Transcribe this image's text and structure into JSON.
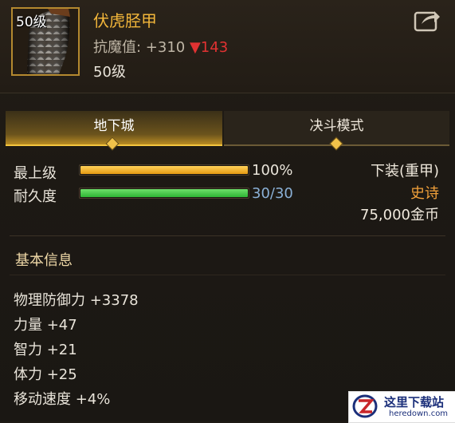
{
  "item": {
    "level_badge": "50级",
    "name": "伏虎胫甲",
    "stat_label": "抗魔值: +310",
    "stat_diff": "▼143",
    "level_text": "50级"
  },
  "tabs": [
    {
      "label": "地下城",
      "active": true
    },
    {
      "label": "决斗模式",
      "active": false
    }
  ],
  "bars": {
    "top_level": {
      "label": "最上级",
      "value_text": "100%",
      "fill": 1.0,
      "color": "#e49a12"
    },
    "durability": {
      "label": "耐久度",
      "value_text": "30/30",
      "fill": 1.0,
      "color": "#2db534"
    }
  },
  "summary": {
    "slot": "下装(重甲)",
    "rarity": "史诗",
    "price": "75,000金币"
  },
  "basic_info": {
    "title": "基本信息",
    "attributes": [
      "物理防御力 +3378",
      "力量 +47",
      "智力 +21",
      "体力 +25",
      "移动速度 +4%"
    ]
  },
  "watermark": {
    "title": "这里下载站",
    "subtitle": "heredown.com"
  },
  "colors": {
    "accent": "#f2b63a",
    "rarity": "#f2a13a",
    "down": "#e13232",
    "durability_text": "#8ab0d6"
  }
}
